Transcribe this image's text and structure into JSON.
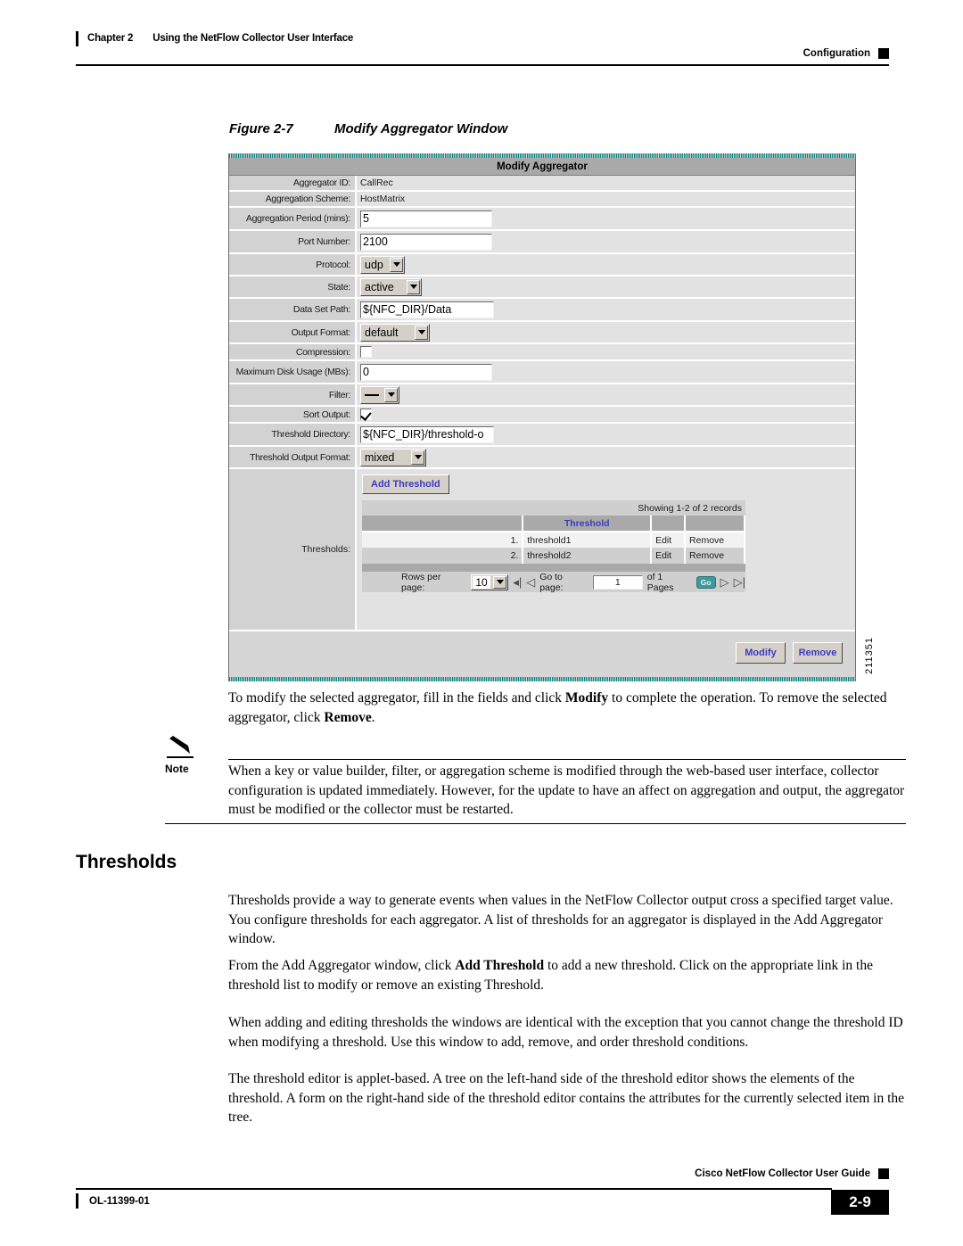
{
  "header": {
    "chapter_num": "Chapter 2",
    "chapter_title": "Using the NetFlow Collector User Interface",
    "section": "Configuration"
  },
  "figure": {
    "label": "Figure 2-7",
    "title": "Modify Aggregator Window",
    "id": "211351"
  },
  "window": {
    "title": "Modify Aggregator",
    "fields": {
      "aggregator_id": {
        "label": "Aggregator ID:",
        "value": "CallRec"
      },
      "aggregation_scheme": {
        "label": "Aggregation Scheme:",
        "value": "HostMatrix"
      },
      "aggregation_period": {
        "label": "Aggregation Period (mins):",
        "value": "5"
      },
      "port_number": {
        "label": "Port Number:",
        "value": "2100"
      },
      "protocol": {
        "label": "Protocol:",
        "value": "udp"
      },
      "state": {
        "label": "State:",
        "value": "active"
      },
      "data_set_path": {
        "label": "Data Set Path:",
        "value": "${NFC_DIR}/Data"
      },
      "output_format": {
        "label": "Output Format:",
        "value": "default"
      },
      "compression": {
        "label": "Compression:",
        "checked": false
      },
      "max_disk_usage": {
        "label": "Maximum Disk Usage (MBs):",
        "value": "0"
      },
      "filter": {
        "label": "Filter:",
        "value": "—"
      },
      "sort_output": {
        "label": "Sort Output:",
        "checked": true
      },
      "threshold_directory": {
        "label": "Threshold Directory:",
        "value": "${NFC_DIR}/threshold-o"
      },
      "threshold_output_format": {
        "label": "Threshold Output Format:",
        "value": "mixed"
      },
      "thresholds": {
        "label": "Thresholds:"
      }
    },
    "thresholds_panel": {
      "add_button": "Add Threshold",
      "records_text": "Showing 1-2 of 2 records",
      "columns": [
        "",
        "Threshold",
        "",
        ""
      ],
      "rows": [
        {
          "num": "1.",
          "name": "threshold1",
          "edit": "Edit",
          "remove": "Remove"
        },
        {
          "num": "2.",
          "name": "threshold2",
          "edit": "Edit",
          "remove": "Remove"
        }
      ],
      "pager": {
        "rows_per_page_label": "Rows per page:",
        "rows_per_page_value": "10",
        "go_to_page_label": "Go to page:",
        "page_value": "1",
        "of_pages_label": "of 1 Pages",
        "go_button": "Go",
        "first_icon": "first-page-icon",
        "prev_icon": "previous-page-icon",
        "next_icon": "next-page-icon",
        "last_icon": "last-page-icon"
      }
    },
    "actions": {
      "modify": "Modify",
      "remove": "Remove"
    }
  },
  "body": {
    "para_modify_1": "To modify the selected aggregator, fill in the fields and click ",
    "para_modify_bold": "Modify",
    "para_modify_2": " to complete the operation. To remove the selected aggregator, click ",
    "para_modify_bold2": "Remove",
    "para_modify_3": ".",
    "note_word": "Note",
    "note_icon": "pencil-note-icon",
    "note_text": "When a key or value builder, filter, or aggregation scheme is modified through the web-based user interface, collector configuration is updated immediately. However, for the update to have an affect on aggregation and output, the aggregator must be modified or the collector must be restarted.",
    "heading": "Thresholds",
    "para_1": "Thresholds provide a way to generate events when values in the NetFlow Collector output cross a specified target value. You configure thresholds for each aggregator. A list of thresholds for an aggregator is displayed in the Add Aggregator window.",
    "para_2a": "From the Add Aggregator window, click ",
    "para_2_bold": "Add Threshold",
    "para_2b": " to add a new threshold. Click on the appropriate link in the threshold list to modify or remove an existing Threshold.",
    "para_3": "When adding and editing thresholds the windows are identical with the exception that you cannot change the threshold ID when modifying a threshold. Use this window to add, remove, and order threshold conditions.",
    "para_4": "The threshold editor is applet-based. A tree on the left-hand side of the threshold editor shows the elements of the threshold. A form on the right-hand side of the threshold editor contains the attributes for the currently selected item in the tree."
  },
  "footer": {
    "guide_title": "Cisco NetFlow Collector User Guide",
    "doc_id": "OL-11399-01",
    "page_number": "2-9"
  }
}
